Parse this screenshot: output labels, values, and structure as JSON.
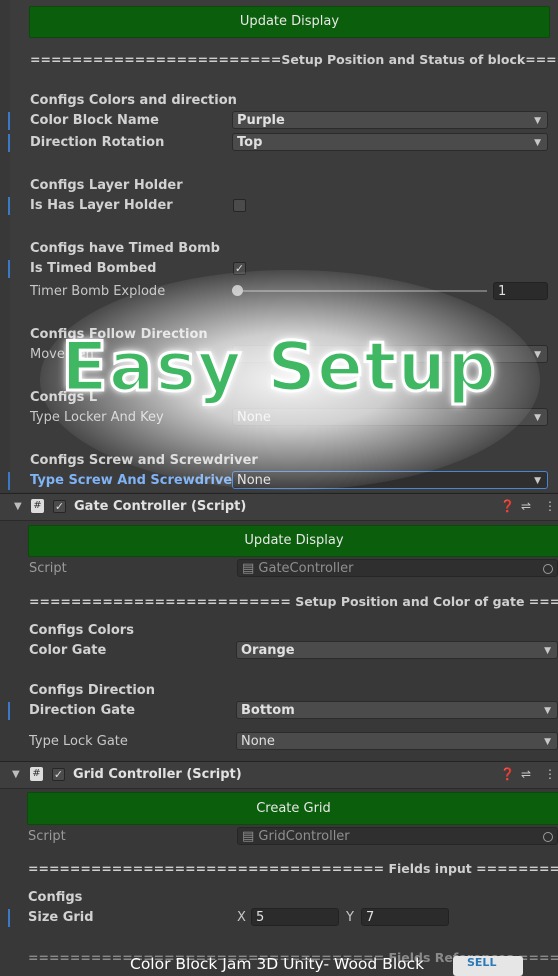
{
  "block_panel": {
    "update_button": "Update Display",
    "separator": "========================Setup Position and Status of block=========",
    "colors_header": "Configs Colors and direction",
    "color_block_name_label": "Color Block Name",
    "color_block_name_value": "Purple",
    "direction_rotation_label": "Direction Rotation",
    "direction_rotation_value": "Top",
    "layer_header": "Configs Layer Holder",
    "is_has_layer_label": "Is Has Layer Holder",
    "is_has_layer_checked": false,
    "timed_header": "Configs have Timed Bomb",
    "is_timed_label": "Is Timed Bombed",
    "is_timed_checked": true,
    "timer_label": "Timer Bomb Explode",
    "timer_value": "1",
    "follow_header": "Configs Follow Direction",
    "movement_label": "Movemen",
    "locker_header": "Configs L",
    "locker_label": "Type Locker And Key",
    "locker_value": "None",
    "screw_header": "Configs Screw and Screwdriver",
    "screw_label": "Type Screw And Screwdriver",
    "screw_value": "None"
  },
  "overlay_title": "Easy Setup",
  "gate_controller": {
    "title": "Gate Controller (Script)",
    "update_button": "Update Display",
    "script_label": "Script",
    "script_value": "GateController",
    "separator": "========================= Setup Position and Color of gate =============",
    "colors_header": "Configs Colors",
    "color_gate_label": "Color Gate",
    "color_gate_value": "Orange",
    "direction_header": "Configs Direction",
    "direction_gate_label": "Direction Gate",
    "direction_gate_value": "Bottom",
    "lock_label": "Type Lock Gate",
    "lock_value": "None"
  },
  "grid_controller": {
    "title": "Grid Controller (Script)",
    "create_button": "Create Grid",
    "script_label": "Script",
    "script_value": "GridController",
    "separator": "================================== Fields input =====================",
    "configs_header": "Configs",
    "size_label": "Size Grid",
    "x_label": "X",
    "x_value": "5",
    "y_label": "Y",
    "y_value": "7",
    "separator2": "================================== Fields References ================"
  },
  "caption": "Color Block Jam 3D Unity- Wood Block",
  "logo_text": "SELL",
  "colors": {
    "green_button": "#0b5e0b",
    "title_green": "#3fb763",
    "selection_blue": "#4a86d4"
  }
}
